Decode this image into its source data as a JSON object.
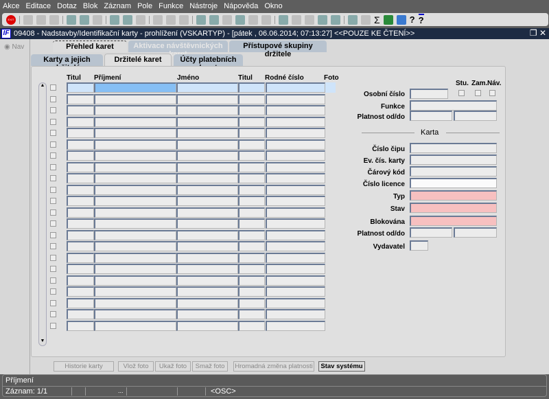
{
  "menu": [
    "Akce",
    "Editace",
    "Dotaz",
    "Blok",
    "Záznam",
    "Pole",
    "Funkce",
    "Nástroje",
    "Nápověda",
    "Okno"
  ],
  "toolbar": {
    "exit_label": "EXIT"
  },
  "window": {
    "title": "09408 - Nadstavby/Identifikační karty - prohlížení (VSKARTYP) - [pátek  , 06.06.2014; 07:13:27] <<POUZE KE ČTENÍ>>",
    "icon": "IF"
  },
  "nav": {
    "label": "Nav"
  },
  "tabs_top": [
    "Přehled karet",
    "Aktivace návštěvnických karet",
    "Přístupové skupiny držitele"
  ],
  "tabs_sub": [
    "Karty a jejich držitelé",
    "Držitelé karet",
    "Účty platebních karet"
  ],
  "grid": {
    "headers": [
      "Titul",
      "Příjmení",
      "Jméno",
      "Titul",
      "Rodné číslo",
      "Foto"
    ],
    "row_count": 22
  },
  "detail": {
    "check_headers": [
      "Stu.",
      "Zam.",
      "Náv."
    ],
    "osobni_cislo": "Osobní číslo",
    "funkce": "Funkce",
    "platnost": "Platnost od/do",
    "section": "Karta",
    "cislo_cipu": "Číslo čipu",
    "ev_cis": "Ev. čís. karty",
    "carovy": "Čárový kód",
    "licence": "Číslo licence",
    "typ": "Typ",
    "stav": "Stav",
    "blokovana": "Blokována",
    "platnost2": "Platnost od/do",
    "vydavatel": "Vydavatel"
  },
  "buttons": [
    "Historie karty",
    "Vlož foto",
    "Ukaž foto",
    "Smaž foto",
    "Hromadná změna platnosti",
    "Stav systému"
  ],
  "status": {
    "field": "Příjmení",
    "record": "Záznam: 1/1",
    "dots": "...",
    "mode": "<OSC>"
  }
}
